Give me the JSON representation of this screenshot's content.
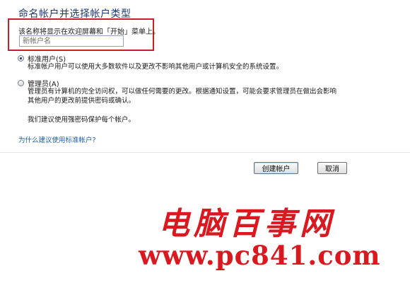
{
  "page": {
    "heading": "命名帐户并选择帐户类型"
  },
  "name_section": {
    "hint": "该名称将显示在欢迎屏幕和「开始」菜单上。",
    "placeholder": "新帐户名"
  },
  "account_types": [
    {
      "label": "标准用户(S)",
      "checked": true,
      "description": [
        "标准帐户用户可以使用大多数软件以及更改不影响其他用户或计算机安全的系统设置。"
      ]
    },
    {
      "label": "管理员(A)",
      "checked": false,
      "description": [
        "管理员有计算机的完全访问权，可以做任何需要的更改。根据通知设置，可能会要求管理员在做出会影响",
        "其他用户的更改前提供密码或确认。"
      ]
    }
  ],
  "recommendation": "我们建议使用强密码保护每个帐户。",
  "help_link": "为什么建议使用标准帐户?",
  "buttons": {
    "create": "创建帐户",
    "cancel": "取消"
  },
  "watermark": {
    "logo_text": "电脑百事网",
    "url": "www.pc841.com"
  },
  "colors": {
    "heading": "#1e3a78",
    "highlight_border": "#c8202a",
    "link": "#1e5fa8",
    "watermark": "#d9181f"
  }
}
